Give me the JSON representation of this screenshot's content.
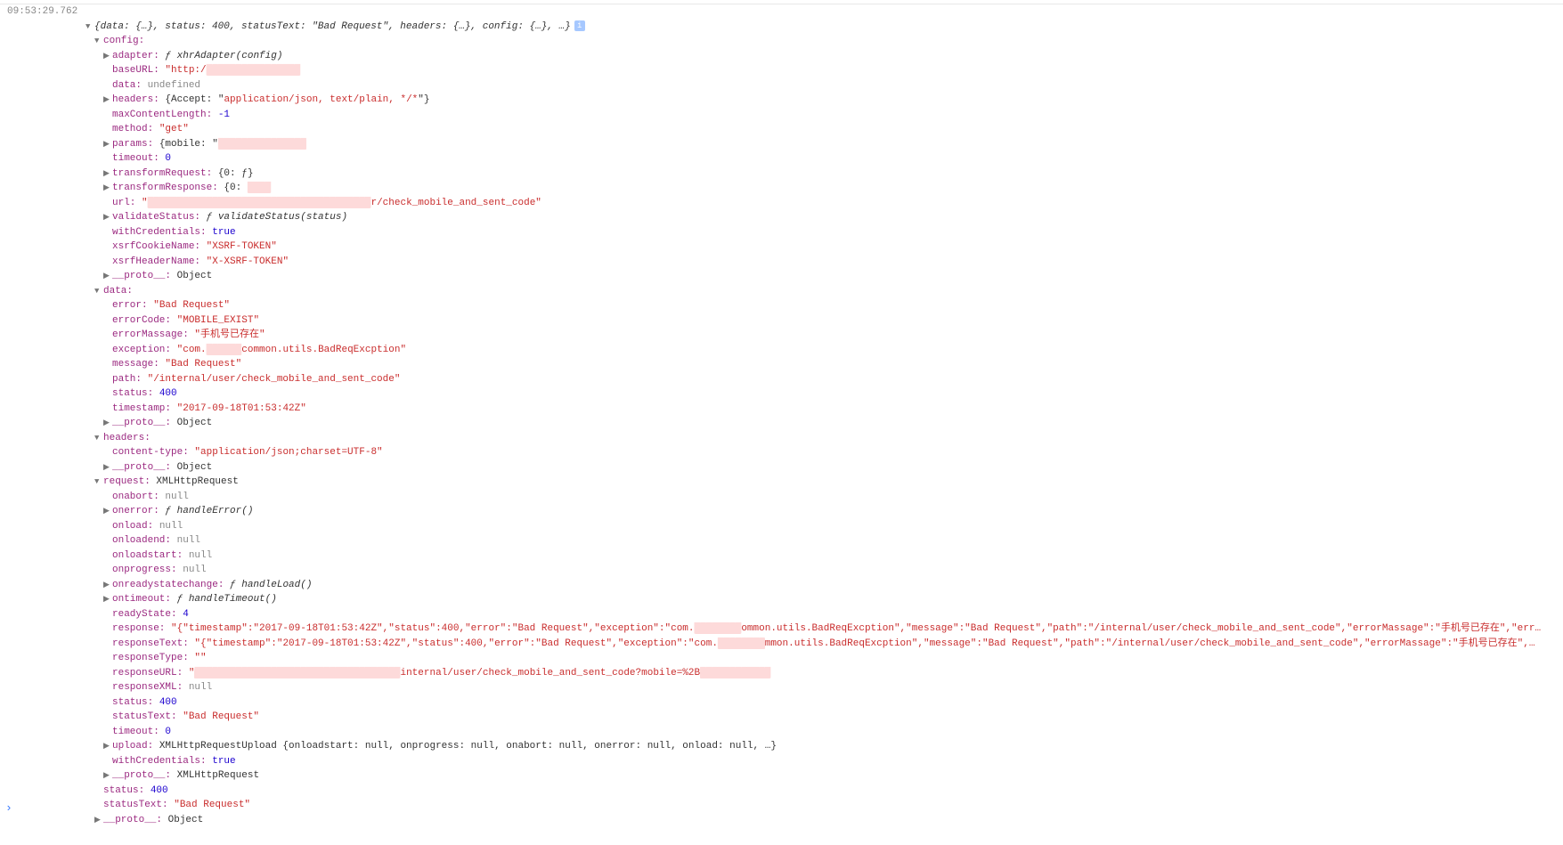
{
  "timestamp": "09:53:29.762",
  "root_summary_prefix": "{data: {…}, status: ",
  "root_status": "400",
  "root_summary_mid1": ", statusText: \"",
  "root_statusText": "Bad Request",
  "root_summary_mid2": "\", headers: {…}, config: {…}, …}",
  "info_icon": "i",
  "config_label": "config:",
  "adapter_key": "adapter: ",
  "adapter_val": "ƒ xhrAdapter(config)",
  "baseURL_key": "baseURL: ",
  "baseURL_val1": "\"http:/",
  "baseURL_redact": "████████████████",
  "data_key": "data: ",
  "data_val": "undefined",
  "cfg_headers_key": "headers: ",
  "cfg_headers_val_pre": "{Accept: \"",
  "cfg_headers_accept": "application/json, text/plain, */*",
  "cfg_headers_val_post": "\"}",
  "maxContentLength_key": "maxContentLength: ",
  "maxContentLength_val": "-1",
  "method_key": "method: ",
  "method_val": "\"get\"",
  "params_key": "params: ",
  "params_val_pre": "{mobile: \"",
  "params_redact": "███████████████",
  "timeout_cfg_key": "timeout: ",
  "timeout_cfg_val": "0",
  "transformRequest_key": "transformRequest: ",
  "transformRequest_val": "{0: ƒ}",
  "transformResponse_key": "transformResponse: ",
  "transformResponse_val_pre": "{0: ",
  "transformResponse_redact": "████",
  "url_key": "url: ",
  "url_val_pre": "\"",
  "url_redact": "██████████████████████████████████████",
  "url_val_post": "r/check_mobile_and_sent_code\"",
  "validateStatus_key": "validateStatus: ",
  "validateStatus_val": "ƒ validateStatus(status)",
  "withCredentials_cfg_key": "withCredentials: ",
  "withCredentials_cfg_val": "true",
  "xsrfCookieName_key": "xsrfCookieName: ",
  "xsrfCookieName_val": "\"XSRF-TOKEN\"",
  "xsrfHeaderName_key": "xsrfHeaderName: ",
  "xsrfHeaderName_val": "\"X-XSRF-TOKEN\"",
  "proto_key": "__proto__: ",
  "proto_obj": "Object",
  "data_section": "data:",
  "error_key": "error: ",
  "error_val": "\"Bad Request\"",
  "errorCode_key": "errorCode: ",
  "errorCode_val": "\"MOBILE_EXIST\"",
  "errorMassage_key": "errorMassage: ",
  "errorMassage_val": "\"手机号已存在\"",
  "exception_key": "exception: ",
  "exception_val_pre": "\"com.",
  "exception_redact": "██████",
  "exception_val_post": "common.utils.BadReqExcption\"",
  "message_key": "message: ",
  "message_val": "\"Bad Request\"",
  "path_key": "path: ",
  "path_val": "\"/internal/user/check_mobile_and_sent_code\"",
  "status_data_key": "status: ",
  "status_data_val": "400",
  "timestamp_data_key": "timestamp: ",
  "timestamp_data_val": "\"2017-09-18T01:53:42Z\"",
  "headers_section": "headers:",
  "contentType_key": "content-type: ",
  "contentType_val": "\"application/json;charset=UTF-8\"",
  "request_key": "request: ",
  "request_val": "XMLHttpRequest",
  "onabort_key": "onabort: ",
  "onabort_val": "null",
  "onerror_key": "onerror: ",
  "onerror_val": "ƒ handleError()",
  "onload_key": "onload: ",
  "onload_val": "null",
  "onloadend_key": "onloadend: ",
  "onloadend_val": "null",
  "onloadstart_key": "onloadstart: ",
  "onloadstart_val": "null",
  "onprogress_key": "onprogress: ",
  "onprogress_val": "null",
  "onreadystatechange_key": "onreadystatechange: ",
  "onreadystatechange_val": "ƒ handleLoad()",
  "ontimeout_key": "ontimeout: ",
  "ontimeout_val": "ƒ handleTimeout()",
  "readyState_key": "readyState: ",
  "readyState_val": "4",
  "response_key": "response: ",
  "response_val_pre": "\"{\"timestamp\":\"2017-09-18T01:53:42Z\",\"status\":400,\"error\":\"Bad Request\",\"exception\":\"com.",
  "response_redact": "████████",
  "response_val_post": "ommon.utils.BadReqExcption\",\"message\":\"Bad Request\",\"path\":\"/internal/user/check_mobile_and_sent_code\",\"errorMassage\":\"手机号已存在\",\"err…",
  "responseText_key": "responseText: ",
  "responseText_val_pre": "\"{\"timestamp\":\"2017-09-18T01:53:42Z\",\"status\":400,\"error\":\"Bad Request\",\"exception\":\"com.",
  "responseText_redact": "████████",
  "responseText_val_post": "mmon.utils.BadReqExcption\",\"message\":\"Bad Request\",\"path\":\"/internal/user/check_mobile_and_sent_code\",\"errorMassage\":\"手机号已存在\",…",
  "responseType_key": "responseType: ",
  "responseType_val": "\"\"",
  "responseURL_key": "responseURL: ",
  "responseURL_val_pre": "\"",
  "responseURL_redact": "███████████████████████████████████",
  "responseURL_val_mid": "internal/user/check_mobile_and_sent_code?mobile=%2B",
  "responseURL_redact2": "████████████",
  "responseXML_key": "responseXML: ",
  "responseXML_val": "null",
  "status_req_key": "status: ",
  "status_req_val": "400",
  "statusText_req_key": "statusText: ",
  "statusText_req_val": "\"Bad Request\"",
  "timeout_req_key": "timeout: ",
  "timeout_req_val": "0",
  "upload_key": "upload: ",
  "upload_val": "XMLHttpRequestUpload {onloadstart: null, onprogress: null, onabort: null, onerror: null, onload: null, …}",
  "withCredentials_req_key": "withCredentials: ",
  "withCredentials_req_val": "true",
  "proto_xhr": "XMLHttpRequest",
  "status_top_key": "status: ",
  "status_top_val": "400",
  "statusText_top_key": "statusText: ",
  "statusText_top_val": "\"Bad Request\"",
  "prompt": "›"
}
